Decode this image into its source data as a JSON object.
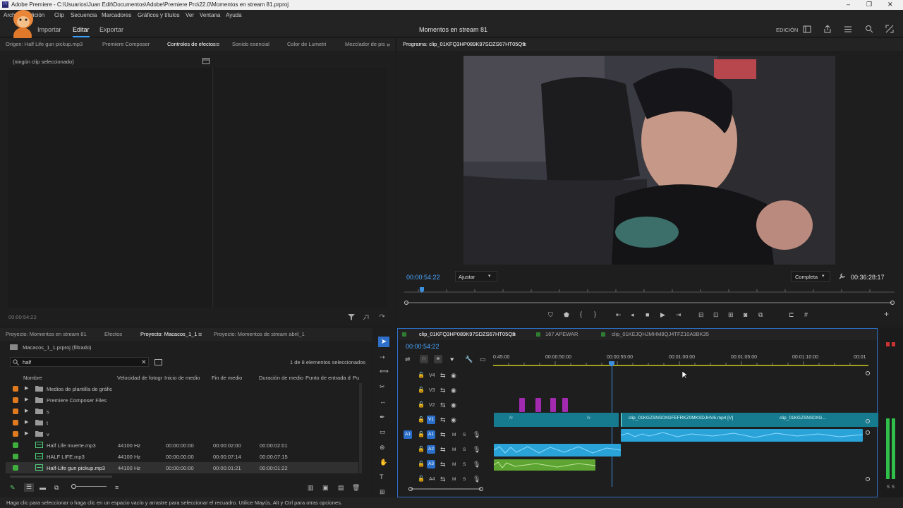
{
  "window": {
    "title": "Adobe Premiere - C:\\Usuarios\\Juan Edit\\Documentos\\Adobe\\Premiere Pro\\22.0\\Momentos en stream 81.prproj",
    "app_badge": "Pr",
    "controls": [
      "–",
      "❐",
      "✕"
    ]
  },
  "menu": [
    "Archivo",
    "Edición",
    "Clip",
    "Secuencia",
    "Marcadores",
    "Gráficos y títulos",
    "Ver",
    "Ventana",
    "Ayuda"
  ],
  "workspace": {
    "tabs": [
      "Importar",
      "Editar",
      "Exportar"
    ],
    "active": "Editar",
    "project_name": "Momentos en stream 81",
    "mode_label": "EDICIÓN"
  },
  "source_panel": {
    "tabs": [
      "Origen: Half Life gun pickup.mp3",
      "Premiere Composer",
      "Controles de efectos",
      "Sonido esencial",
      "Color de Lumetri",
      "Mezclador de pis"
    ],
    "active_tab": "Controles de efectos",
    "no_clip_text": "(ningún clip seleccionado)",
    "timecode": "00:00:54:22"
  },
  "program_monitor": {
    "title": "Programa: clip_01KFQ3HP089K97SDZS67HT05Q9",
    "timecode": "00:00:54:22",
    "fit_label": "Ajustar",
    "quality_label": "Completa",
    "duration": "00:36:28:17"
  },
  "project_panel": {
    "tabs": [
      "Proyecto: Momentos en stream 81",
      "Efectos",
      "Proyecto: Macacos_1_1",
      "Proyecto: Momentos de stream abril_1"
    ],
    "active_tab": "Proyecto: Macacos_1_1",
    "bin_path": "Macacos_1_1.prproj (filtrado)",
    "search_value": "half",
    "selection_count": "1 de 8 elementos seleccionados",
    "columns": [
      "Nombre",
      "Velocidad de fotogr",
      "Inicio de medio",
      "Fin de medio",
      "Duración de medio",
      "Punto de entrada d",
      "Pu"
    ],
    "folders": [
      {
        "name": "Medios de plantilla de gráfic",
        "color": "#e07a1f"
      },
      {
        "name": "Premiere Composer Files",
        "color": "#e07a1f"
      },
      {
        "name": "s",
        "color": "#e07a1f"
      },
      {
        "name": "t",
        "color": "#e07a1f"
      },
      {
        "name": "v",
        "color": "#e07a1f"
      }
    ],
    "files": [
      {
        "name": "Half Life muerte.mp3",
        "rate": "44100 Hz",
        "start": "00:00:00:00",
        "end": "00:00:02:00",
        "duration": "00:00:02:01",
        "color": "#3fae3f"
      },
      {
        "name": "HALF LIFE.mp3",
        "rate": "44100 Hz",
        "start": "00:00:00:00",
        "end": "00:00:07:14",
        "duration": "00:00:07:15",
        "color": "#3fae3f"
      },
      {
        "name": "Half-Life gun pickup.mp3",
        "rate": "44100 Hz",
        "start": "00:00:00:00",
        "end": "00:00:01:21",
        "duration": "00:00:01:22",
        "color": "#3fae3f"
      }
    ]
  },
  "timeline": {
    "tabs": [
      "clip_01KFQ3HP089K97SDZS67HT05Q9",
      "167 APEWAR",
      "clip_01KEJQHJMHM8QJ4TFZ10A9BK35"
    ],
    "timecode": "00:00:54:22",
    "ruler": [
      "0:45:00",
      "00:00:50:00",
      "00:00:55:00",
      "00:01:00:00",
      "00:01:05:00",
      "00:01:10:00",
      "00:01"
    ],
    "video_tracks": [
      "V4",
      "V3",
      "V2",
      "V1"
    ],
    "audio_tracks": [
      "A1",
      "A2",
      "A3",
      "A4"
    ],
    "source_patch_audio": "A1",
    "track_buttons": [
      "M",
      "S"
    ],
    "clip_v1_a": "clip_01KGZSNS0XGFEFRKZ0MKSDJHV6.mp4 [V]",
    "clip_v1_b": "clip_01KGZSNS0XG...",
    "fx_label": "fx",
    "meter_labels": [
      "S",
      "S"
    ]
  },
  "colors": {
    "accent": "#2d8ceb",
    "video_clip": "#177b8f",
    "audio_clip": "#2aa4d8",
    "audio_green": "#5da432",
    "purple_clip": "#a12ab0"
  },
  "status_text": "Haga clic para seleccionar o haga clic en un espacio vacío y arrastre para seleccionar el recuadro. Utilice Mayús, Alt y Ctrl para otras opciones."
}
